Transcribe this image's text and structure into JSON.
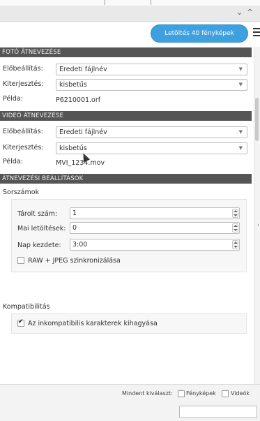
{
  "window": {
    "minimize_glyph": "⌄",
    "maximize_glyph": "^",
    "menu_icon": "hamburger-menu-icon"
  },
  "header": {
    "download_button": "Letöltés 40 fényképek"
  },
  "photo_rename": {
    "title": "FOTÓ ÁTNEVEZÉSE",
    "preset_label": "Előbeállítás:",
    "preset_value": "Eredeti fájlnév",
    "extension_label": "Kiterjesztés:",
    "extension_value": "kisbetűs",
    "example_label": "Példa:",
    "example_value": "P6210001.orf"
  },
  "video_rename": {
    "title": "VIDEÓ ÁTNEVEZÉSE",
    "preset_label": "Előbeállítás:",
    "preset_value": "Eredeti fájlnév",
    "extension_label": "Kiterjesztés:",
    "extension_value": "kisbetűs",
    "example_label": "Példa:",
    "example_value": "MVI_1234.mov"
  },
  "rename_settings": {
    "title": "ÁTNEVEZÉSI BEÁLLÍTÁSOK",
    "sequences_title": "Sorszámok",
    "stored_label": "Tárolt szám:",
    "stored_value": "1",
    "downloads_today_label": "Mai letöltések:",
    "downloads_today_value": "0",
    "day_start_label": "Nap kezdete:",
    "day_start_value": "3:00",
    "sync_raw_jpeg_label": "RAW + JPEG szinkronizálása",
    "sync_raw_jpeg_checked": false,
    "compat_title": "Kompatibilitás",
    "skip_incompatible_label": "Az inkompatibilis karakterek kihagyása",
    "skip_incompatible_checked": true
  },
  "footer": {
    "select_all_label": "Mindent kiválaszt:",
    "photos_label": "Fényképek",
    "photos_checked": false,
    "videos_label": "Videók",
    "videos_checked": false
  }
}
